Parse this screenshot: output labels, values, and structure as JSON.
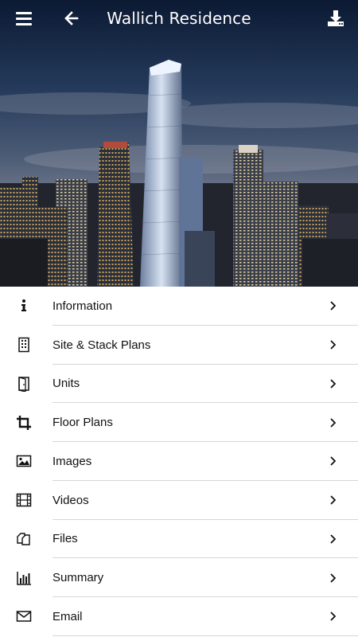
{
  "header": {
    "title": "Wallich Residence",
    "menu_icon": "hamburger-menu-icon",
    "back_icon": "arrow-left-icon",
    "download_icon": "download-icon"
  },
  "menu": {
    "items": [
      {
        "label": "Information",
        "icon": "info-icon"
      },
      {
        "label": "Site & Stack Plans",
        "icon": "building-icon"
      },
      {
        "label": "Units",
        "icon": "door-icon"
      },
      {
        "label": "Floor Plans",
        "icon": "crop-icon"
      },
      {
        "label": "Images",
        "icon": "image-icon"
      },
      {
        "label": "Videos",
        "icon": "film-icon"
      },
      {
        "label": "Files",
        "icon": "files-icon"
      },
      {
        "label": "Summary",
        "icon": "bar-chart-icon"
      },
      {
        "label": "Email",
        "icon": "envelope-icon"
      }
    ]
  },
  "colors": {
    "header_text": "#ffffff",
    "row_text": "#111111",
    "divider": "#d6d6d6"
  }
}
